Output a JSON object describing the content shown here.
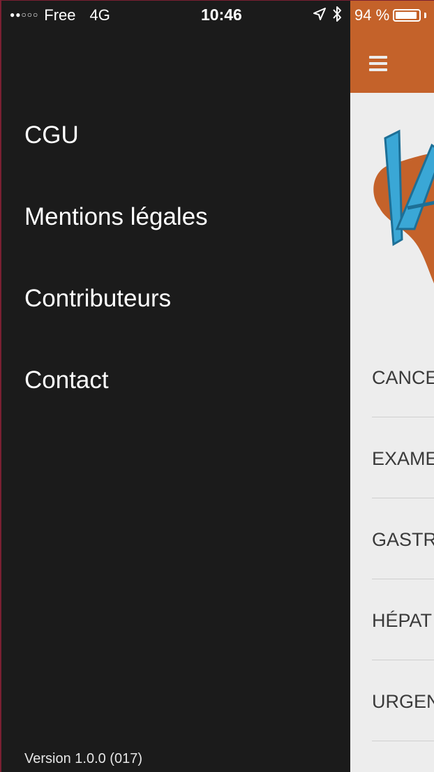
{
  "status_bar": {
    "signal": "●●○○○",
    "carrier": "Free",
    "network": "4G",
    "time": "10:46",
    "battery_percent": "94 %"
  },
  "drawer": {
    "items": [
      {
        "label": "CGU"
      },
      {
        "label": "Mentions légales"
      },
      {
        "label": "Contributeurs"
      },
      {
        "label": "Contact"
      }
    ],
    "version": "Version 1.0.0 (017)"
  },
  "main": {
    "header_color": "#c4622a",
    "list": [
      {
        "label": "CANCE"
      },
      {
        "label": "EXAME"
      },
      {
        "label": "GASTR"
      },
      {
        "label": "HÉPAT"
      },
      {
        "label": "URGEN"
      }
    ]
  }
}
